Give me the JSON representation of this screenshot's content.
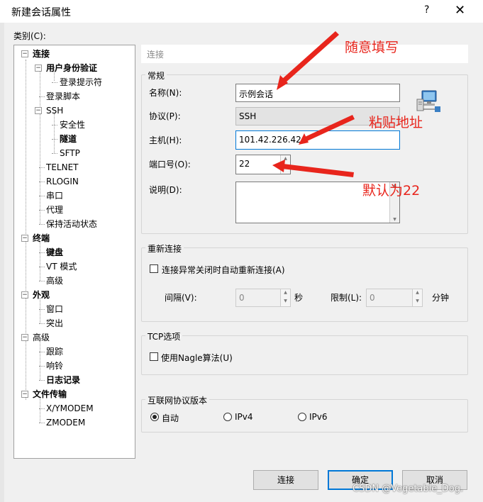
{
  "window": {
    "title": "新建会话属性",
    "help_label": "?",
    "close_label": "✕"
  },
  "category_label": "类别(C):",
  "tree": [
    {
      "label": "连接",
      "bold": true,
      "box": "−"
    },
    {
      "label": "用户身份验证",
      "bold": true,
      "box": "−"
    },
    {
      "label": "登录提示符",
      "bold": false
    },
    {
      "label": "登录脚本",
      "bold": false
    },
    {
      "label": "SSH",
      "bold": false,
      "box": "−"
    },
    {
      "label": "安全性",
      "bold": false
    },
    {
      "label": "隧道",
      "bold": true
    },
    {
      "label": "SFTP",
      "bold": false
    },
    {
      "label": "TELNET",
      "bold": false
    },
    {
      "label": "RLOGIN",
      "bold": false
    },
    {
      "label": "串口",
      "bold": false
    },
    {
      "label": "代理",
      "bold": false
    },
    {
      "label": "保持活动状态",
      "bold": false
    },
    {
      "label": "终端",
      "bold": true,
      "box": "−"
    },
    {
      "label": "键盘",
      "bold": true
    },
    {
      "label": "VT 模式",
      "bold": false
    },
    {
      "label": "高级",
      "bold": false
    },
    {
      "label": "外观",
      "bold": true,
      "box": "−"
    },
    {
      "label": "窗口",
      "bold": false
    },
    {
      "label": "突出",
      "bold": false
    },
    {
      "label": "高级",
      "bold": false,
      "box": "−"
    },
    {
      "label": "跟踪",
      "bold": false
    },
    {
      "label": "响铃",
      "bold": false
    },
    {
      "label": "日志记录",
      "bold": true
    },
    {
      "label": "文件传输",
      "bold": true,
      "box": "−"
    },
    {
      "label": "X/YMODEM",
      "bold": false
    },
    {
      "label": "ZMODEM",
      "bold": false
    }
  ],
  "panel": {
    "header": "连接",
    "general": {
      "title": "常规",
      "name_label": "名称(N):",
      "name_value": "示例会话",
      "protocol_label": "协议(P):",
      "protocol_value": "SSH",
      "host_label": "主机(H):",
      "host_value": "101.42.226.42",
      "port_label": "端口号(O):",
      "port_value": "22",
      "desc_label": "说明(D):",
      "desc_value": ""
    },
    "reconnect": {
      "title": "重新连接",
      "checkbox_label": "连接异常关闭时自动重新连接(A)",
      "interval_label": "间隔(V):",
      "interval_value": "0",
      "interval_unit": "秒",
      "limit_label": "限制(L):",
      "limit_value": "0",
      "limit_unit": "分钟"
    },
    "tcp": {
      "title": "TCP选项",
      "nagle_label": "使用Nagle算法(U)"
    },
    "ipver": {
      "title": "互联网协议版本",
      "auto_label": "自动",
      "ipv4_label": "IPv4",
      "ipv6_label": "IPv6",
      "selected": "自动"
    }
  },
  "buttons": {
    "connect": "连接",
    "ok": "确定",
    "cancel": "取消"
  },
  "annotations": {
    "fill_any": "随意填写",
    "paste_address": "粘贴地址",
    "default_22": "默认为22"
  },
  "watermark": "CSDN @Vegetable_Dog.",
  "colors": {
    "annotation": "#e8251c",
    "focus_border": "#0078d7"
  }
}
